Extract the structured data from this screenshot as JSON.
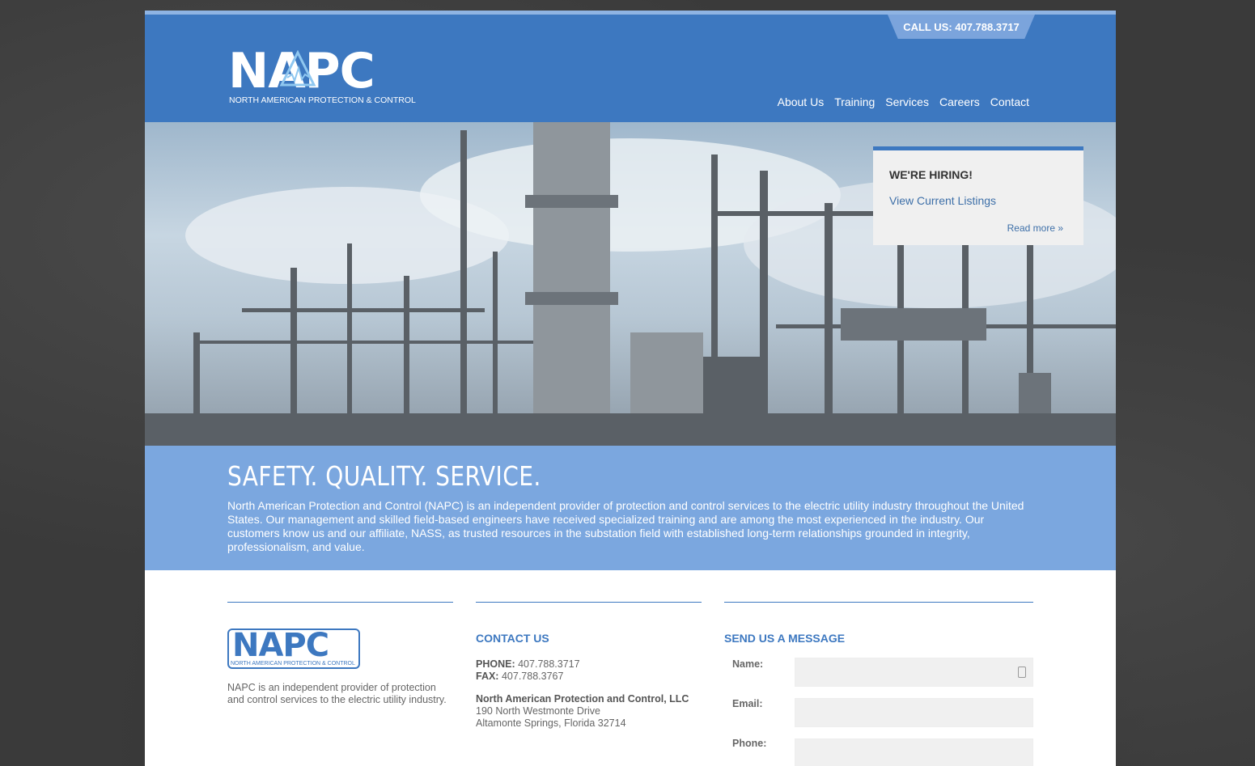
{
  "header": {
    "call_us": "CALL US: 407.788.3717",
    "logo_text": "NAPC",
    "logo_subtitle": "NORTH AMERICAN PROTECTION & CONTROL",
    "nav": [
      "About Us",
      "Training",
      "Services",
      "Careers",
      "Contact"
    ]
  },
  "hiring": {
    "title": "WE'RE HIRING!",
    "link": "View Current Listings",
    "read_more": "Read more »"
  },
  "intro": {
    "heading": "SAFETY. QUALITY. SERVICE.",
    "body": "North American Protection and Control (NAPC) is an independent provider of protection and control services to the electric utility industry throughout the United States. Our management and skilled field-based engineers have received specialized training and are among the most experienced in the industry. Our customers know us and our affiliate, NASS, as trusted resources in the substation field with established long-term relationships grounded in integrity, professionalism, and value."
  },
  "footer": {
    "logo_text": "NAPC",
    "logo_subtitle": "NORTH AMERICAN PROTECTION & CONTROL",
    "description": "NAPC is an independent provider of protection and control services to the electric utility industry.",
    "contact": {
      "title": "CONTACT US",
      "phone_label": "PHONE:",
      "phone": "407.788.3717",
      "fax_label": "FAX:",
      "fax": "407.788.3767",
      "company": "North American Protection and Control, LLC",
      "address1": "190 North Westmonte Drive",
      "address2": "Altamonte Springs, Florida 32714"
    },
    "form": {
      "title": "SEND US A MESSAGE",
      "name_label": "Name:",
      "email_label": "Email:",
      "phone_label": "Phone:"
    }
  },
  "colors": {
    "primary": "#3d78c0",
    "band": "#7ba7df",
    "tab": "#7ba4dc"
  }
}
